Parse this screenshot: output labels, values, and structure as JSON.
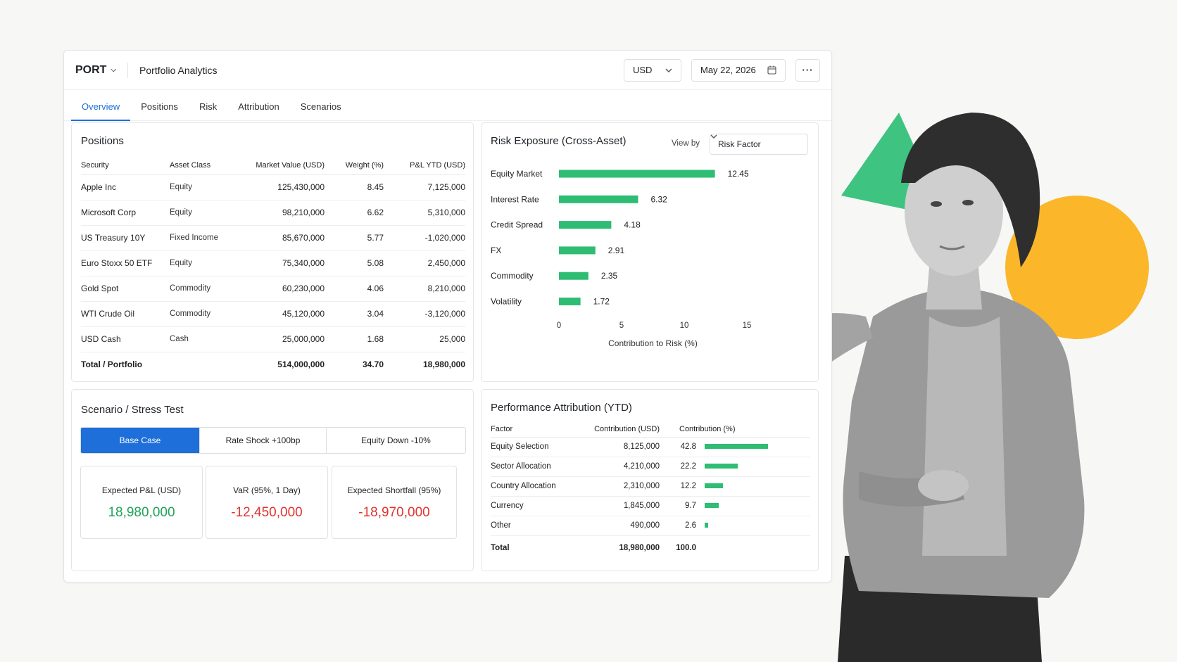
{
  "header": {
    "brand": "PORT",
    "app_title": "Portfolio Analytics",
    "currency": "USD",
    "date": "May 22, 2026"
  },
  "tabs": [
    "Overview",
    "Positions",
    "Risk",
    "Attribution",
    "Scenarios"
  ],
  "positions": {
    "title": "Positions",
    "columns": [
      "Security",
      "Asset Class",
      "Market Value (USD)",
      "Weight (%)",
      "P&L YTD (USD)"
    ],
    "rows": [
      {
        "security": "Apple Inc",
        "asset_class": "Equity",
        "market_value": "125,430,000",
        "weight": "8.45",
        "pnl": "7,125,000",
        "sign": "pos"
      },
      {
        "security": "Microsoft Corp",
        "asset_class": "Equity",
        "market_value": "98,210,000",
        "weight": "6.62",
        "pnl": "5,310,000",
        "sign": "pos"
      },
      {
        "security": "US Treasury 10Y",
        "asset_class": "Fixed Income",
        "market_value": "85,670,000",
        "weight": "5.77",
        "pnl": "-1,020,000",
        "sign": "neg"
      },
      {
        "security": "Euro Stoxx 50 ETF",
        "asset_class": "Equity",
        "market_value": "75,340,000",
        "weight": "5.08",
        "pnl": "2,450,000",
        "sign": "pos"
      },
      {
        "security": "Gold Spot",
        "asset_class": "Commodity",
        "market_value": "60,230,000",
        "weight": "4.06",
        "pnl": "8,210,000",
        "sign": "pos"
      },
      {
        "security": "WTI Crude Oil",
        "asset_class": "Commodity",
        "market_value": "45,120,000",
        "weight": "3.04",
        "pnl": "-3,120,000",
        "sign": "neg"
      },
      {
        "security": "USD Cash",
        "asset_class": "Cash",
        "market_value": "25,000,000",
        "weight": "1.68",
        "pnl": "25,000",
        "sign": "pos"
      }
    ],
    "total": {
      "label": "Total / Portfolio",
      "market_value": "514,000,000",
      "weight": "34.70",
      "pnl": "18,980,000"
    }
  },
  "risk": {
    "title": "Risk Exposure (Cross-Asset)",
    "view_by_label": "View by",
    "view_by_value": "Risk Factor"
  },
  "chart_data": {
    "type": "bar",
    "orientation": "horizontal",
    "categories": [
      "Equity Market",
      "Interest Rate",
      "Credit Spread",
      "FX",
      "Commodity",
      "Volatility"
    ],
    "values": [
      12.45,
      6.32,
      4.18,
      2.91,
      2.35,
      1.72
    ],
    "xlabel": "Contribution to Risk (%)",
    "xlim": [
      0,
      15
    ],
    "xticks": [
      0,
      5,
      10,
      15
    ],
    "bar_color": "#2ebd73"
  },
  "scenario": {
    "title": "Scenario / Stress Test",
    "options": [
      "Base Case",
      "Rate Shock +100bp",
      "Equity Down -10%"
    ],
    "selected": "Base Case",
    "kpis": [
      {
        "label": "Expected P&L (USD)",
        "value": "18,980,000",
        "sign": "pos"
      },
      {
        "label": "VaR (95%, 1 Day)",
        "value": "-12,450,000",
        "sign": "neg"
      },
      {
        "label": "Expected Shortfall (95%)",
        "value": "-18,970,000",
        "sign": "neg"
      }
    ]
  },
  "attribution": {
    "title": "Performance Attribution (YTD)",
    "columns": [
      "Factor",
      "Contribution (USD)",
      "Contribution (%)"
    ],
    "rows": [
      {
        "factor": "Equity Selection",
        "usd": "8,125,000",
        "pct": "42.8",
        "pct_value": 42.8
      },
      {
        "factor": "Sector Allocation",
        "usd": "4,210,000",
        "pct": "22.2",
        "pct_value": 22.2
      },
      {
        "factor": "Country Allocation",
        "usd": "2,310,000",
        "pct": "12.2",
        "pct_value": 12.2
      },
      {
        "factor": "Currency",
        "usd": "1,845,000",
        "pct": "9.7",
        "pct_value": 9.7
      },
      {
        "factor": "Other",
        "usd": "490,000",
        "pct": "2.6",
        "pct_value": 2.6
      }
    ],
    "total": {
      "label": "Total",
      "usd": "18,980,000",
      "pct": "100.0"
    }
  },
  "colors": {
    "accent": "#1e6fd9",
    "positive": "#22a35a",
    "negative": "#e0342f",
    "bar": "#2ebd73",
    "deco_triangle": "#3fc381",
    "deco_circle": "#fbb62a"
  }
}
